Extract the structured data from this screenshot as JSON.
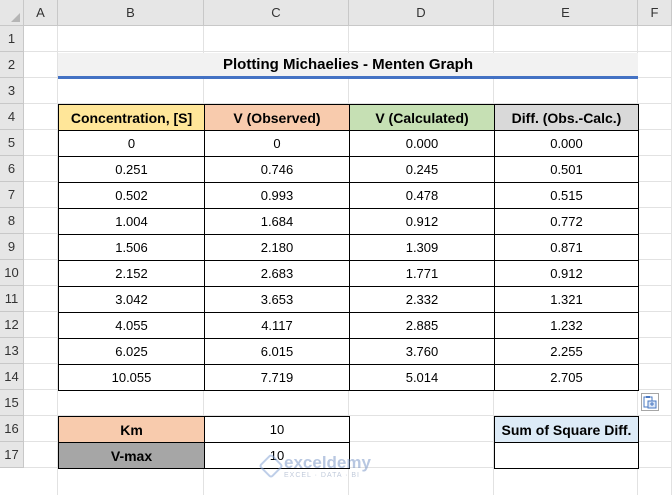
{
  "columns": [
    "A",
    "B",
    "C",
    "D",
    "E",
    "F"
  ],
  "rows": [
    "1",
    "2",
    "3",
    "4",
    "5",
    "6",
    "7",
    "8",
    "9",
    "10",
    "11",
    "12",
    "13",
    "14",
    "15",
    "16",
    "17"
  ],
  "title": "Plotting Michaelies - Menten Graph",
  "table": {
    "headers": [
      "Concentration, [S]",
      "V (Observed)",
      "V (Calculated)",
      "Diff. (Obs.-Calc.)"
    ],
    "header_colors": [
      "#ffe699",
      "#f8cbad",
      "#c6e0b4",
      "#d9d9d9"
    ],
    "data": [
      [
        "0",
        "0",
        "0.000",
        "0.000"
      ],
      [
        "0.251",
        "0.746",
        "0.245",
        "0.501"
      ],
      [
        "0.502",
        "0.993",
        "0.478",
        "0.515"
      ],
      [
        "1.004",
        "1.684",
        "0.912",
        "0.772"
      ],
      [
        "1.506",
        "2.180",
        "1.309",
        "0.871"
      ],
      [
        "2.152",
        "2.683",
        "1.771",
        "0.912"
      ],
      [
        "3.042",
        "3.653",
        "2.332",
        "1.321"
      ],
      [
        "4.055",
        "4.117",
        "2.885",
        "1.232"
      ],
      [
        "6.025",
        "6.015",
        "3.760",
        "2.255"
      ],
      [
        "10.055",
        "7.719",
        "5.014",
        "2.705"
      ]
    ]
  },
  "params": [
    {
      "label": "Km",
      "value": "10",
      "color": "#f8cbad"
    },
    {
      "label": "V-max",
      "value": "10",
      "color": "#a6a6a6"
    }
  ],
  "sum_box": {
    "label": "Sum of Square Diff.",
    "value": "",
    "color": "#ddebf7"
  },
  "watermark": {
    "name": "exceldemy",
    "tagline": "EXCEL · DATA · BI"
  },
  "icons": {
    "paste_options": "paste-options-icon",
    "select_all": "select-all-triangle-icon"
  }
}
